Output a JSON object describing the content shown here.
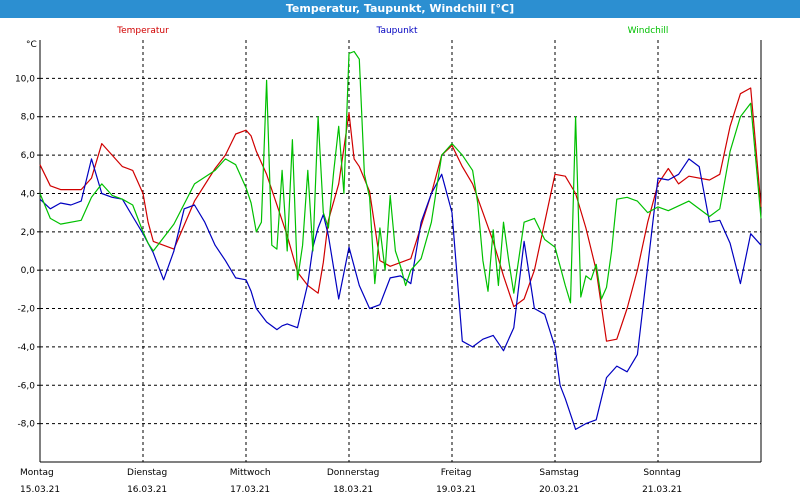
{
  "window": {
    "title": "Temperatur, Taupunkt, Windchill [°C]"
  },
  "colors": {
    "titlebar": "#2c8fd1",
    "temperature": "#d00000",
    "dewpoint": "#0000c0",
    "windchill": "#00c000",
    "grid": "#000000"
  },
  "chart_data": {
    "type": "line",
    "title": "Temperatur, Taupunkt, Windchill [°C]",
    "y_unit": "°C",
    "ylim": [
      -10.0,
      12.0
    ],
    "y_ticks": [
      -8.0,
      -6.0,
      -4.0,
      -2.0,
      0.0,
      2.0,
      4.0,
      6.0,
      8.0,
      10.0
    ],
    "y_tick_labels": [
      "-8,0",
      "-6,0",
      "-4,0",
      "-2,0",
      "0,0",
      "2,0",
      "4,0",
      "6,0",
      "8,0",
      "10,0"
    ],
    "xlim": [
      0,
      7
    ],
    "x_day_labels": [
      {
        "day": "Montag",
        "date": "15.03.21"
      },
      {
        "day": "Dienstag",
        "date": "16.03.21"
      },
      {
        "day": "Mittwoch",
        "date": "17.03.21"
      },
      {
        "day": "Donnerstag",
        "date": "18.03.21"
      },
      {
        "day": "Freitag",
        "date": "19.03.21"
      },
      {
        "day": "Samstag",
        "date": "20.03.21"
      },
      {
        "day": "Sonntag",
        "date": "21.03.21"
      }
    ],
    "grid": true,
    "series": [
      {
        "name": "Temperatur",
        "color": "#d00000",
        "x": [
          0,
          0.1,
          0.2,
          0.4,
          0.5,
          0.6,
          0.7,
          0.8,
          0.9,
          1.0,
          1.05,
          1.1,
          1.3,
          1.5,
          1.7,
          1.8,
          1.9,
          2.0,
          2.05,
          2.1,
          2.2,
          2.35,
          2.4,
          2.5,
          2.6,
          2.7,
          2.75,
          2.8,
          2.9,
          3.0,
          3.05,
          3.1,
          3.2,
          3.3,
          3.4,
          3.6,
          3.7,
          3.8,
          3.9,
          4.0,
          4.1,
          4.2,
          4.3,
          4.4,
          4.5,
          4.6,
          4.7,
          4.8,
          5.0,
          5.1,
          5.2,
          5.3,
          5.4,
          5.5,
          5.6,
          5.7,
          5.8,
          5.9,
          6.0,
          6.1,
          6.2,
          6.3,
          6.5,
          6.6,
          6.7,
          6.8,
          6.9,
          7.0
        ],
        "values": [
          5.5,
          4.4,
          4.2,
          4.2,
          4.8,
          6.6,
          6.0,
          5.4,
          5.2,
          4.0,
          2.5,
          1.5,
          1.1,
          3.6,
          5.3,
          6.0,
          7.1,
          7.3,
          7.0,
          6.2,
          5.0,
          2.6,
          1.8,
          -0.1,
          -0.8,
          -1.2,
          0.4,
          2.6,
          4.5,
          8.2,
          5.8,
          5.4,
          4.1,
          0.5,
          0.2,
          0.6,
          2.3,
          4.0,
          6.0,
          6.5,
          5.4,
          4.5,
          3.0,
          1.5,
          -0.3,
          -1.9,
          -1.5,
          0.0,
          5.0,
          4.9,
          4.0,
          2.2,
          0.0,
          -3.7,
          -3.6,
          -2.0,
          0.0,
          2.5,
          4.5,
          5.3,
          4.5,
          4.9,
          4.7,
          5.0,
          7.5,
          9.2,
          9.5,
          3.3
        ]
      },
      {
        "name": "Taupunkt",
        "color": "#0000c0",
        "x": [
          0,
          0.1,
          0.2,
          0.3,
          0.4,
          0.5,
          0.6,
          0.7,
          0.8,
          0.9,
          1.0,
          1.1,
          1.2,
          1.3,
          1.4,
          1.5,
          1.6,
          1.7,
          1.8,
          1.9,
          2.0,
          2.05,
          2.1,
          2.2,
          2.3,
          2.35,
          2.4,
          2.5,
          2.6,
          2.65,
          2.7,
          2.75,
          2.8,
          2.9,
          3.0,
          3.1,
          3.2,
          3.3,
          3.4,
          3.5,
          3.6,
          3.7,
          3.8,
          3.9,
          4.0,
          4.1,
          4.2,
          4.3,
          4.4,
          4.5,
          4.6,
          4.7,
          4.8,
          4.9,
          5.0,
          5.05,
          5.1,
          5.2,
          5.3,
          5.4,
          5.5,
          5.6,
          5.7,
          5.8,
          6.0,
          6.1,
          6.2,
          6.3,
          6.4,
          6.5,
          6.6,
          6.7,
          6.8,
          6.9,
          7.0
        ],
        "values": [
          3.7,
          3.2,
          3.5,
          3.4,
          3.6,
          5.8,
          4.0,
          3.8,
          3.7,
          2.8,
          1.9,
          0.9,
          -0.5,
          1.0,
          3.2,
          3.4,
          2.5,
          1.3,
          0.5,
          -0.4,
          -0.5,
          -1.1,
          -2.0,
          -2.7,
          -3.1,
          -2.9,
          -2.8,
          -3.0,
          -0.7,
          1.2,
          2.2,
          2.9,
          1.8,
          -1.5,
          1.2,
          -0.8,
          -2.0,
          -1.8,
          -0.4,
          -0.3,
          -0.7,
          2.5,
          4.0,
          5.0,
          3.0,
          -3.7,
          -4.0,
          -3.6,
          -3.4,
          -4.2,
          -3.0,
          1.5,
          -2.0,
          -2.3,
          -4.0,
          -6.0,
          -6.7,
          -8.3,
          -8.0,
          -7.8,
          -5.6,
          -5.0,
          -5.3,
          -4.4,
          4.8,
          4.7,
          5.0,
          5.8,
          5.4,
          2.5,
          2.6,
          1.4,
          -0.7,
          1.9,
          1.3
        ]
      },
      {
        "name": "Windchill",
        "color": "#00c000",
        "x": [
          0,
          0.1,
          0.2,
          0.4,
          0.5,
          0.6,
          0.7,
          0.8,
          0.9,
          1.0,
          1.05,
          1.1,
          1.3,
          1.5,
          1.7,
          1.8,
          1.9,
          2.0,
          2.05,
          2.1,
          2.15,
          2.2,
          2.25,
          2.3,
          2.35,
          2.4,
          2.45,
          2.5,
          2.55,
          2.6,
          2.65,
          2.7,
          2.75,
          2.8,
          2.85,
          2.9,
          2.95,
          3.0,
          3.05,
          3.1,
          3.15,
          3.2,
          3.25,
          3.3,
          3.35,
          3.4,
          3.45,
          3.5,
          3.55,
          3.6,
          3.7,
          3.8,
          3.9,
          4.0,
          4.1,
          4.2,
          4.25,
          4.3,
          4.35,
          4.4,
          4.45,
          4.5,
          4.55,
          4.6,
          4.7,
          4.8,
          4.9,
          5.0,
          5.1,
          5.15,
          5.2,
          5.25,
          5.3,
          5.35,
          5.4,
          5.45,
          5.5,
          5.55,
          5.6,
          5.7,
          5.8,
          5.9,
          6.0,
          6.1,
          6.3,
          6.5,
          6.6,
          6.7,
          6.8,
          6.9,
          7.0
        ],
        "values": [
          4.0,
          2.7,
          2.4,
          2.6,
          3.8,
          4.5,
          3.9,
          3.7,
          3.4,
          2.0,
          1.4,
          1.0,
          2.4,
          4.5,
          5.2,
          5.8,
          5.5,
          4.3,
          3.5,
          2.0,
          2.5,
          9.9,
          1.3,
          1.1,
          5.2,
          1.0,
          6.8,
          -0.5,
          1.3,
          5.2,
          1.0,
          8.0,
          3.0,
          2.2,
          5.1,
          7.5,
          4.0,
          11.3,
          11.4,
          11.0,
          5.0,
          3.8,
          -0.7,
          2.2,
          0.0,
          3.9,
          1.0,
          0.2,
          -0.8,
          0.0,
          0.6,
          2.5,
          6.0,
          6.6,
          6.0,
          5.2,
          3.5,
          0.5,
          -1.1,
          2.1,
          -0.8,
          2.5,
          0.5,
          -1.2,
          2.5,
          2.7,
          1.6,
          1.2,
          -0.8,
          -1.7,
          8.0,
          -1.4,
          -0.3,
          -0.5,
          0.3,
          -1.5,
          -0.9,
          1.0,
          3.7,
          3.8,
          3.6,
          3.0,
          3.3,
          3.1,
          3.6,
          2.8,
          3.2,
          6.2,
          8.0,
          8.7,
          2.7
        ]
      }
    ]
  }
}
